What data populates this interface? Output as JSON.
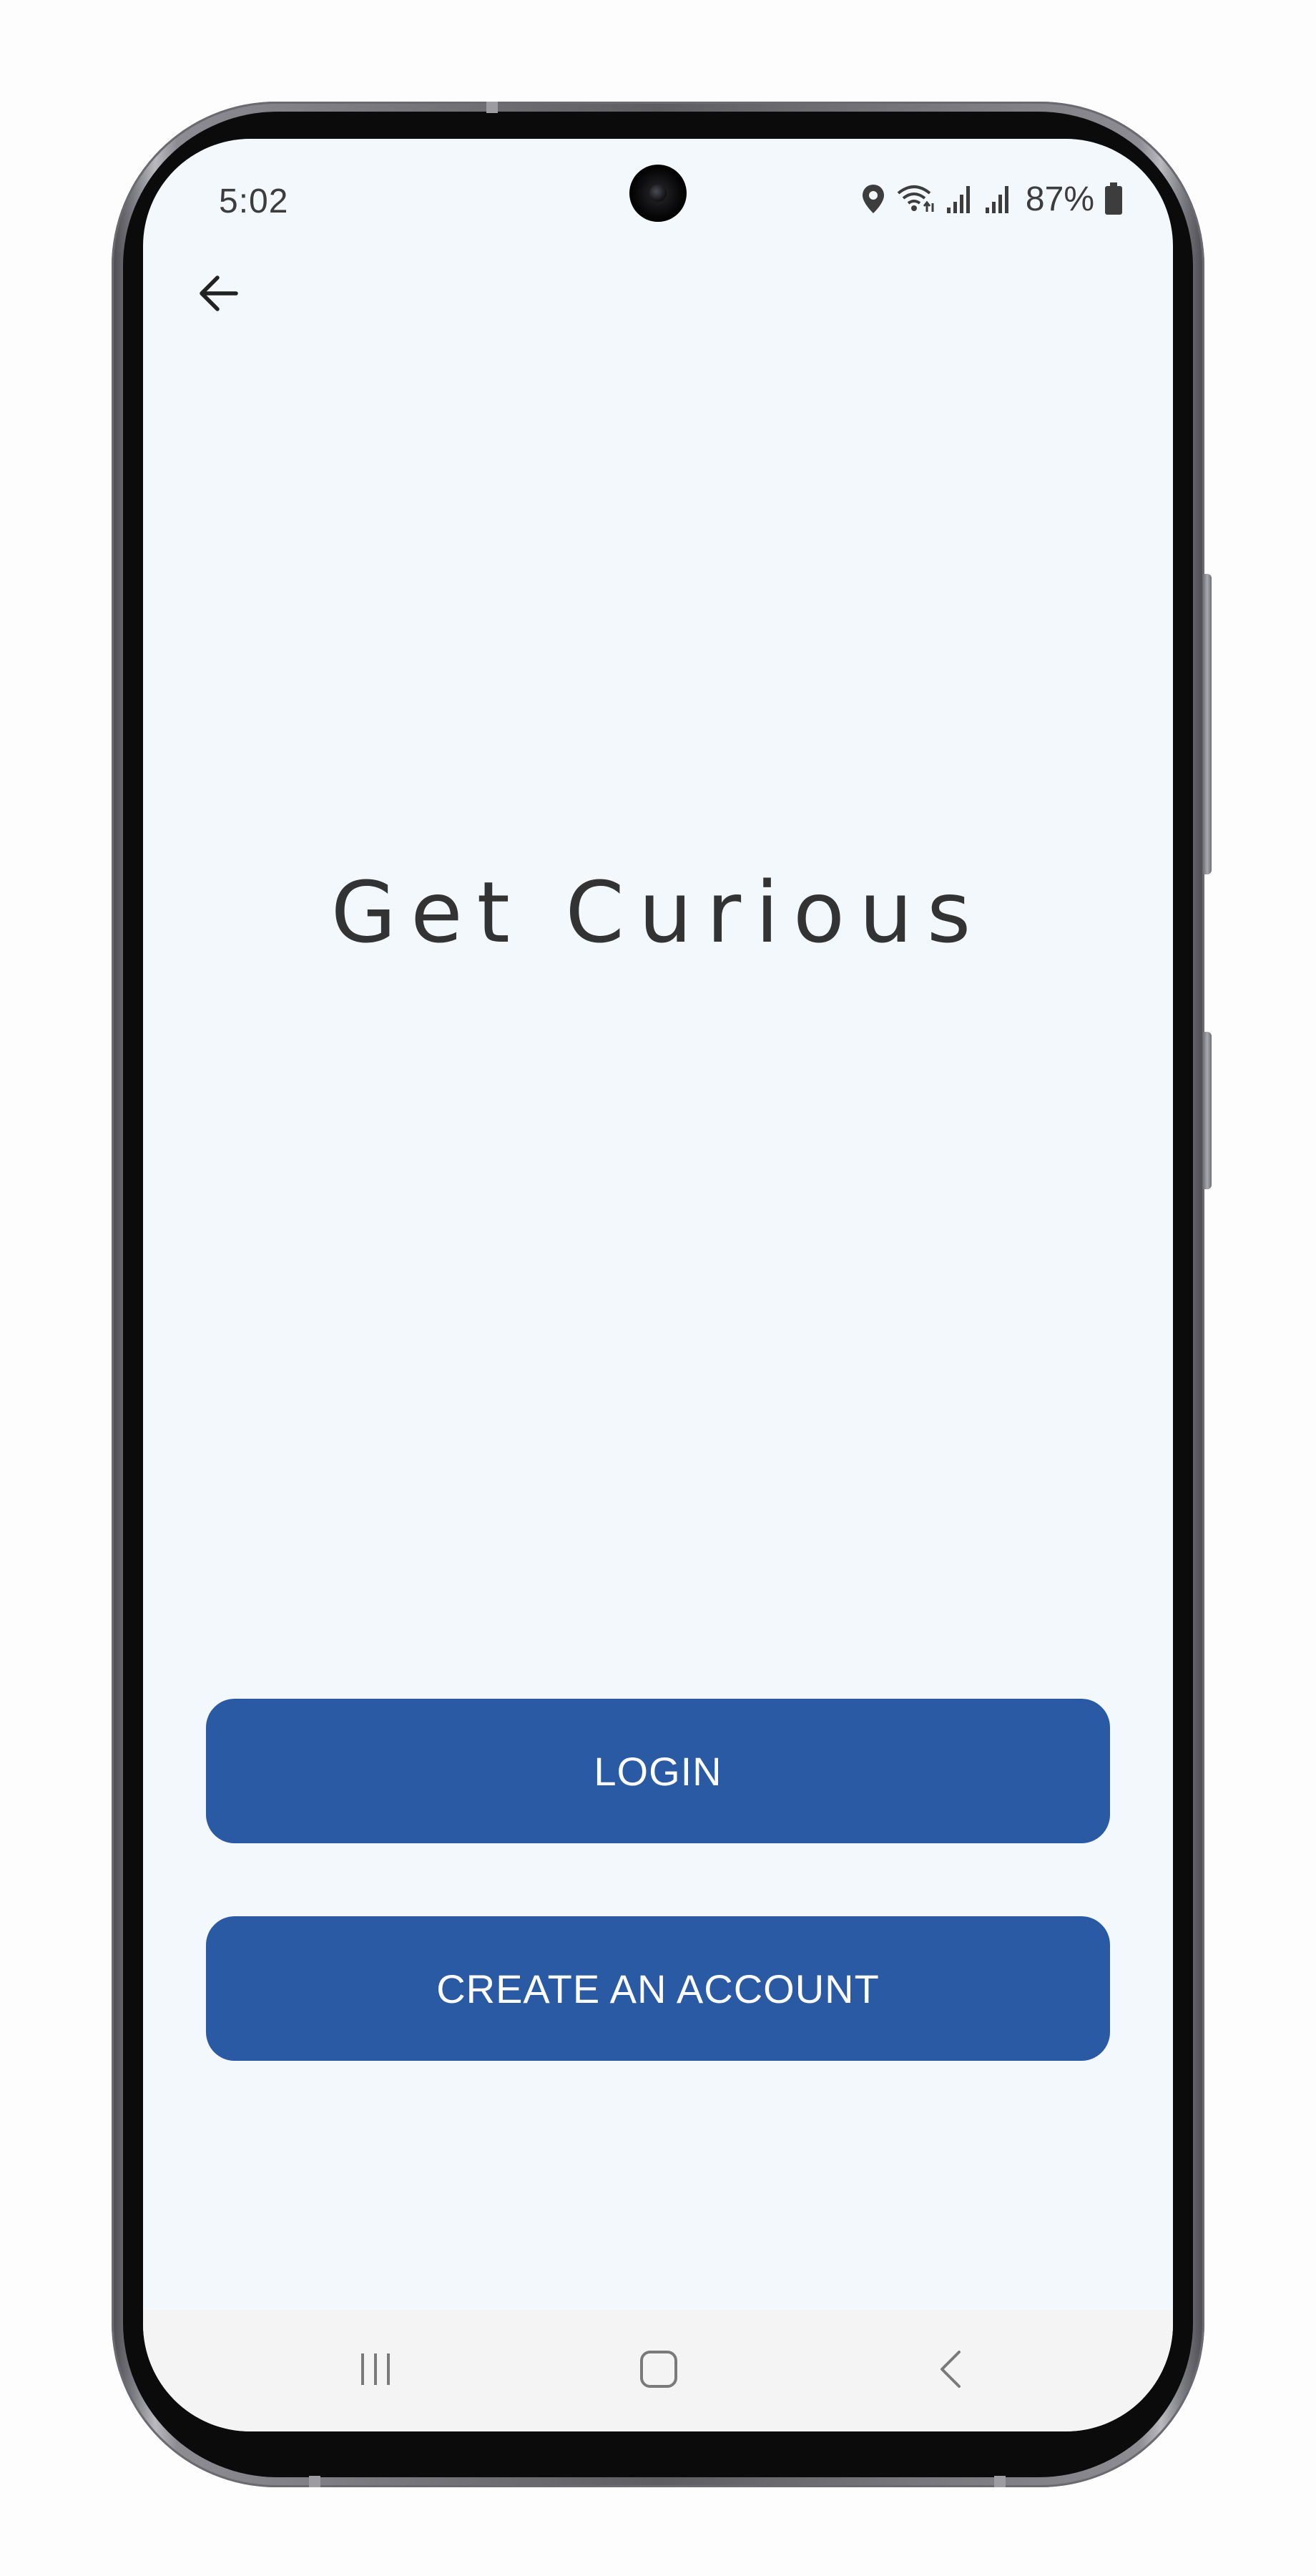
{
  "status_bar": {
    "time": "5:02",
    "battery_percent": "87%",
    "icons": [
      "location-icon",
      "wifi-icon",
      "signal-icon",
      "signal-icon",
      "battery-icon"
    ]
  },
  "top_bar": {
    "back_icon": "arrow-left-icon"
  },
  "main": {
    "headline": "Get Curious"
  },
  "actions": {
    "login_label": "LOGIN",
    "create_account_label": "CREATE AN ACCOUNT"
  },
  "nav_bar": {
    "icons": [
      "recents-icon",
      "home-icon",
      "back-chevron-icon"
    ]
  },
  "colors": {
    "screen_background": "#f3f8fd",
    "button_primary": "#2b5aa4",
    "button_text": "#ffffff",
    "headline_text": "#333333",
    "nav_bar_background": "#f4f4f5"
  }
}
